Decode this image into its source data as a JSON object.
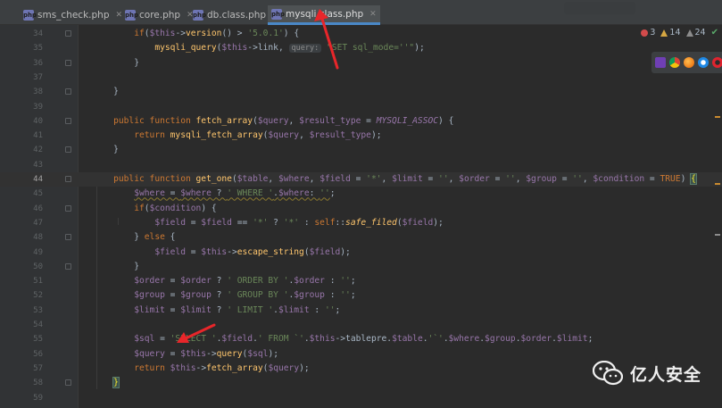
{
  "tabs": [
    {
      "label": "sms_check.php",
      "active": false
    },
    {
      "label": "core.php",
      "active": false
    },
    {
      "label": "db.class.php",
      "active": false
    },
    {
      "label": "mysqli.class.php",
      "active": true
    }
  ],
  "inspections": {
    "errors": "3",
    "warnings": "14",
    "weak_warnings": "24"
  },
  "browser_icons": [
    "phpstorm-icon",
    "chrome-icon",
    "firefox-icon",
    "safari-icon",
    "opera-icon",
    "edge-icon"
  ],
  "current_line": "44",
  "code_lines": [
    {
      "n": "34",
      "html": "        <span class=\"kw\">if</span>(<span class=\"var\">$this</span>-><span class=\"fn\">version</span>() > <span class=\"str\">'5.0.1'</span>) {"
    },
    {
      "n": "35",
      "html": "            <span class=\"fn\">mysqli_query</span>(<span class=\"var\">$this</span>->link, <span class=\"hint\">query:</span> <span class=\"str\">\"SET sql_mode=''\"</span>);"
    },
    {
      "n": "36",
      "html": "        }"
    },
    {
      "n": "37",
      "html": ""
    },
    {
      "n": "38",
      "html": "    }"
    },
    {
      "n": "39",
      "html": ""
    },
    {
      "n": "40",
      "html": "    <span class=\"kw\">public function</span> <span class=\"fn\">fetch_array</span>(<span class=\"var\">$query</span>, <span class=\"var\">$result_type</span> = <span class=\"cst\">MYSQLI_ASSOC</span>) {"
    },
    {
      "n": "41",
      "html": "        <span class=\"kw\">return</span> <span class=\"fn\">mysqli_fetch_array</span>(<span class=\"var\">$query</span>, <span class=\"var\">$result_type</span>);"
    },
    {
      "n": "42",
      "html": "    }"
    },
    {
      "n": "43",
      "html": ""
    },
    {
      "n": "44",
      "html": "    <span class=\"kw\">public function</span> <span class=\"fn\">get_one</span>(<span class=\"var\">$table</span>, <span class=\"var\">$where</span>, <span class=\"var\">$field</span> = <span class=\"str\">'*'</span>, <span class=\"var\">$limit</span> = <span class=\"str\">''</span>, <span class=\"var\">$order</span> = <span class=\"str\">''</span>, <span class=\"var\">$group</span> = <span class=\"str\">''</span>, <span class=\"var\">$condition</span> = <span class=\"kw\">TRUE</span>) <span class=\"brace-hl\">{</span>"
    },
    {
      "n": "45",
      "html": "        <span class=\"warn-underline\"><span class=\"var\">$where</span> = <span class=\"var\">$where</span> ? <span class=\"str\">' WHERE '</span>.<span class=\"var\">$where</span>: <span class=\"str\">''</span></span>;"
    },
    {
      "n": "46",
      "html": "        <span class=\"kw\">if</span>(<span class=\"var\">$condition</span>) {"
    },
    {
      "n": "47",
      "html": "            <span class=\"var\">$field</span> = <span class=\"var\">$field</span> == <span class=\"str\">'*'</span> ? <span class=\"str\">'*'</span> : <span class=\"kw\">self</span>::<span class=\"itf\">safe_filed</span>(<span class=\"var\">$field</span>);"
    },
    {
      "n": "48",
      "html": "        } <span class=\"kw\">else</span> {"
    },
    {
      "n": "49",
      "html": "            <span class=\"var\">$field</span> = <span class=\"var\">$this</span>-><span class=\"fn\">escape_string</span>(<span class=\"var\">$field</span>);"
    },
    {
      "n": "50",
      "html": "        }"
    },
    {
      "n": "51",
      "html": "        <span class=\"var\">$order</span> = <span class=\"var\">$order</span> ? <span class=\"str\">' ORDER BY '</span>.<span class=\"var\">$order</span> : <span class=\"str\">''</span>;"
    },
    {
      "n": "52",
      "html": "        <span class=\"var\">$group</span> = <span class=\"var\">$group</span> ? <span class=\"str\">' GROUP BY '</span>.<span class=\"var\">$group</span> : <span class=\"str\">''</span>;"
    },
    {
      "n": "53",
      "html": "        <span class=\"var\">$limit</span> = <span class=\"var\">$limit</span> ? <span class=\"str\">' LIMIT '</span>.<span class=\"var\">$limit</span> : <span class=\"str\">''</span>;"
    },
    {
      "n": "54",
      "html": ""
    },
    {
      "n": "55",
      "html": "        <span class=\"var\">$sql</span> = <span class=\"str\">'SELECT '</span>.<span class=\"var\">$field</span>.<span class=\"str\">' FROM `'</span>.<span class=\"var\">$this</span>->tablepre.<span class=\"var\">$table</span>.<span class=\"str\">'`'</span>.<span class=\"var\">$where</span>.<span class=\"var\">$group</span>.<span class=\"var\">$order</span>.<span class=\"var\">$limit</span>;"
    },
    {
      "n": "56",
      "html": "        <span class=\"var\">$query</span> = <span class=\"var\">$this</span>-><span class=\"fn\">query</span>(<span class=\"var\">$sql</span>);"
    },
    {
      "n": "57",
      "html": "        <span class=\"kw\">return</span> <span class=\"var\">$this</span>-><span class=\"fn\">fetch_array</span>(<span class=\"var\">$query</span>);"
    },
    {
      "n": "58",
      "html": "    <span class=\"brace-hl\">}</span>"
    },
    {
      "n": "59",
      "html": ""
    }
  ],
  "watermark": {
    "text": "亿人安全"
  },
  "colors": {
    "accent": "#4a88c7",
    "error": "#d24b4b",
    "warning": "#d6a742",
    "arrow": "#e8262a"
  }
}
